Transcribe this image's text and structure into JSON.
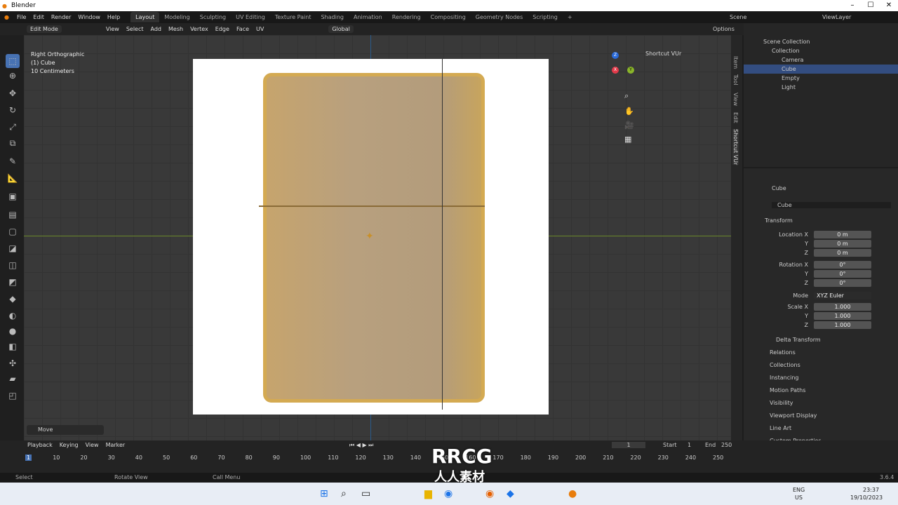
{
  "app": {
    "title": "Blender"
  },
  "menus": [
    "File",
    "Edit",
    "Render",
    "Window",
    "Help"
  ],
  "workspaces": [
    "Layout",
    "Modeling",
    "Sculpting",
    "UV Editing",
    "Texture Paint",
    "Shading",
    "Animation",
    "Rendering",
    "Compositing",
    "Geometry Nodes",
    "Scripting"
  ],
  "scene": {
    "label": "Scene",
    "view_layer": "ViewLayer"
  },
  "header": {
    "mode": "Edit Mode",
    "menus": [
      "View",
      "Select",
      "Add",
      "Mesh",
      "Vertex",
      "Edge",
      "Face",
      "UV"
    ],
    "orientation": "Global",
    "options": "Options"
  },
  "viewport": {
    "view": "Right Orthographic",
    "object": "(1) Cube",
    "scale": "10 Centimeters",
    "shortcut_panel": "Shortcut VUr",
    "last_op": "Move",
    "npanel_tabs": [
      "Item",
      "Tool",
      "View",
      "Edit",
      "Shortcut VUr"
    ]
  },
  "outliner": {
    "root": "Scene Collection",
    "collection": "Collection",
    "items": [
      "Camera",
      "Cube",
      "Empty",
      "Light"
    ]
  },
  "props": {
    "object": "Cube",
    "data": "Cube",
    "transform": "Transform",
    "location_label": "Location X",
    "rotation_label": "Rotation X",
    "scale_label": "Scale X",
    "loc": [
      "0 m",
      "0 m",
      "0 m"
    ],
    "rot": [
      "0°",
      "0°",
      "0°"
    ],
    "mode_label": "Mode",
    "mode": "XYZ Euler",
    "scale": [
      "1.000",
      "1.000",
      "1.000"
    ],
    "delta": "Delta Transform",
    "sections": [
      "Relations",
      "Collections",
      "Instancing",
      "Motion Paths",
      "Visibility",
      "Viewport Display",
      "Line Art",
      "Custom Properties"
    ],
    "y": "Y",
    "z": "Z"
  },
  "timeline": {
    "menus": [
      "Playback",
      "Keying",
      "View",
      "Marker"
    ],
    "frame": "1",
    "start_label": "Start",
    "start": "1",
    "end_label": "End",
    "end": "250",
    "ticks": [
      "1",
      "10",
      "20",
      "30",
      "40",
      "50",
      "60",
      "70",
      "80",
      "90",
      "100",
      "110",
      "120",
      "130",
      "140",
      "150",
      "160",
      "170",
      "180",
      "190",
      "200",
      "210",
      "220",
      "230",
      "240",
      "250"
    ]
  },
  "status": {
    "select": "Select",
    "rotate": "Rotate View",
    "menu": "Call Menu",
    "version": "3.6.4"
  },
  "taskbar": {
    "lang": "ENG",
    "region": "US",
    "time": "23:37",
    "date": "19/10/2023"
  },
  "watermark": {
    "text": "RRCG",
    "sub": "人人素材"
  }
}
